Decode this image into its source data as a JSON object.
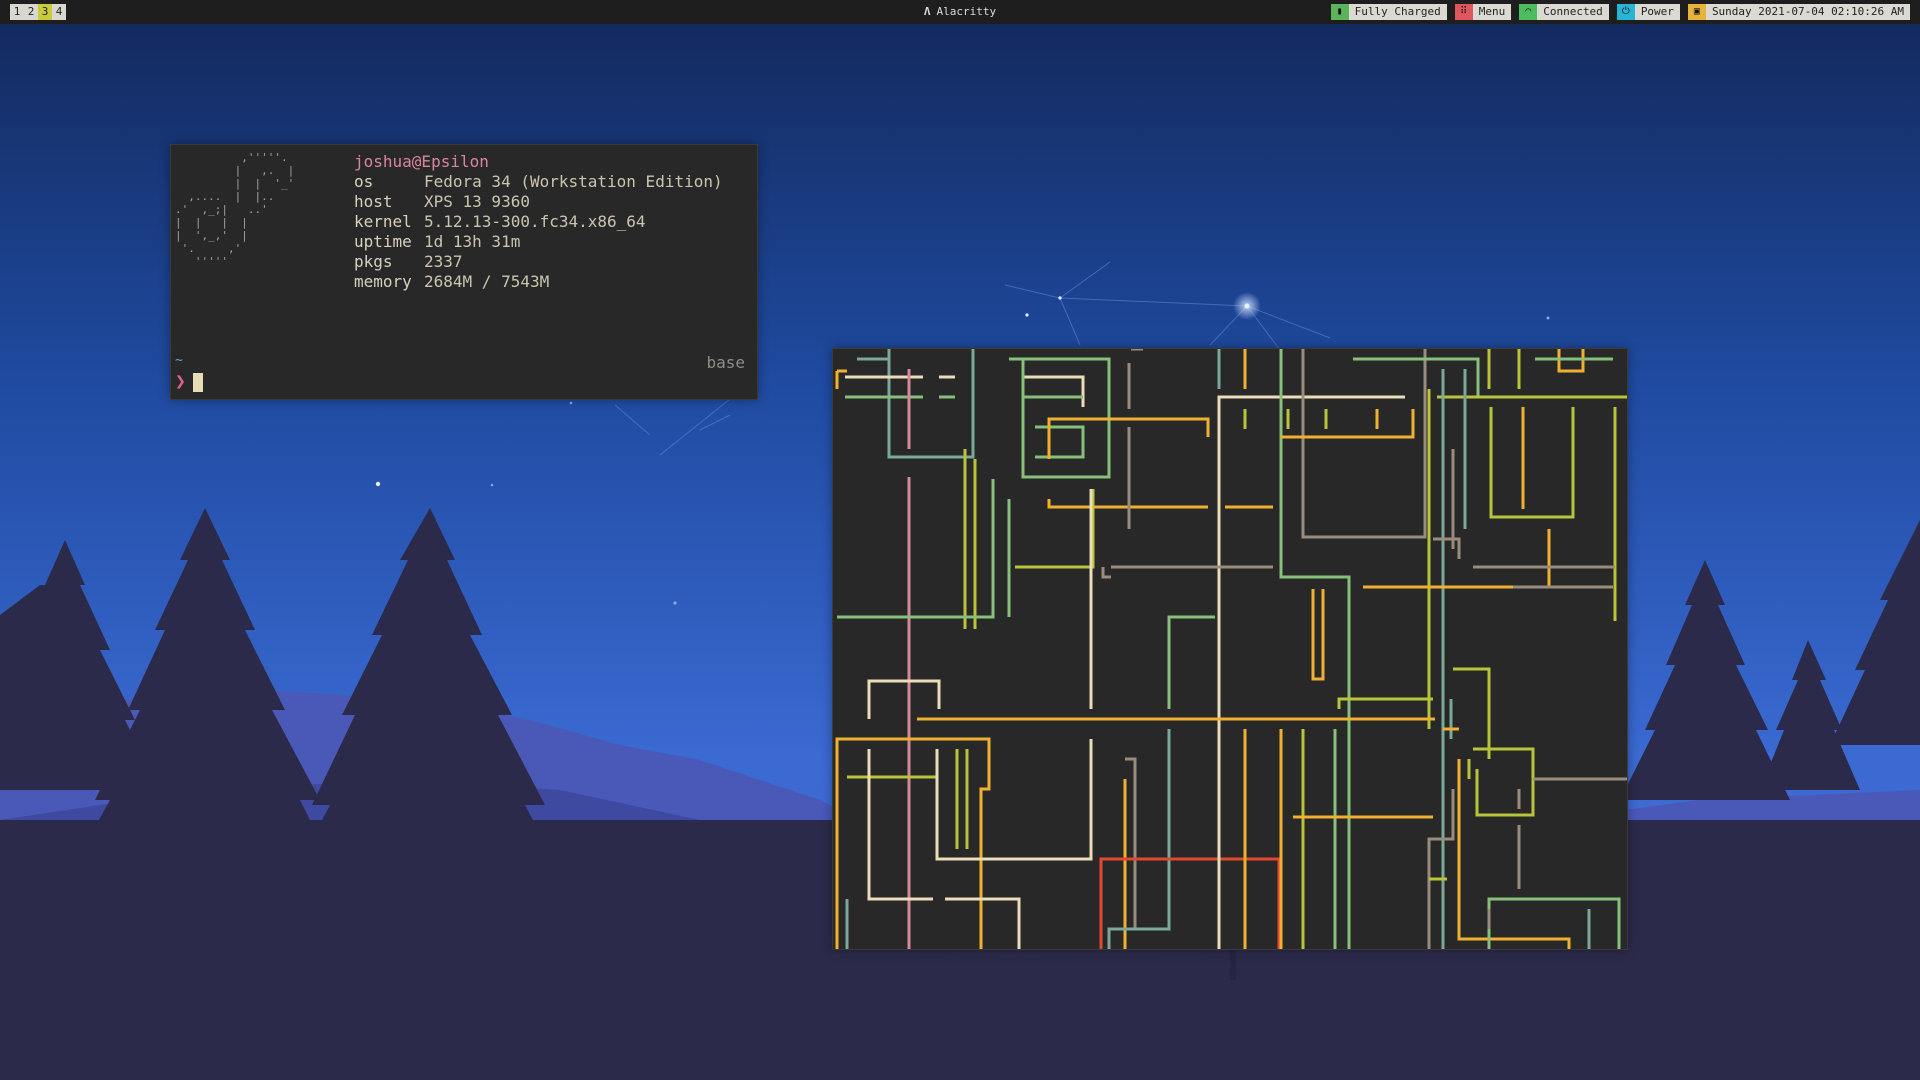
{
  "workspaces": [
    "1",
    "2",
    "3",
    "4"
  ],
  "active_workspace": "3",
  "window_title": "Alacritty",
  "status_modules": [
    {
      "name": "battery",
      "icon": "battery-icon",
      "label": "Fully Charged",
      "color": "#5ab45a"
    },
    {
      "name": "menu",
      "icon": "grid-icon",
      "label": "Menu",
      "color": "#e0565e"
    },
    {
      "name": "network",
      "icon": "wifi-icon",
      "label": "Connected",
      "color": "#4cbc5e"
    },
    {
      "name": "power",
      "icon": "power-icon",
      "label": "Power",
      "color": "#26b5d4"
    },
    {
      "name": "clock",
      "icon": "calendar-icon",
      "label": "Sunday 2021-07-04 02:10:26 AM",
      "color": "#e8b33a"
    }
  ],
  "fetch": {
    "user": "joshua@Epsilon",
    "rows": [
      {
        "key": "os",
        "value": "Fedora 34 (Workstation Edition)"
      },
      {
        "key": "host",
        "value": "XPS 13 9360"
      },
      {
        "key": "kernel",
        "value": "5.12.13-300.fc34.x86_64"
      },
      {
        "key": "uptime",
        "value": "1d 13h 31m"
      },
      {
        "key": "pkgs",
        "value": "2337"
      },
      {
        "key": "memory",
        "value": "2684M / 7543M"
      }
    ],
    "env": "base",
    "prompt_dir": "~",
    "prompt_symbol": "❯"
  },
  "colors": {
    "bar_bg": "#1e1e1e",
    "terminal_bg": "#282828",
    "pipe_orange": "#f0b030",
    "pipe_green": "#86c07a",
    "pipe_lime": "#b8c43a",
    "pipe_cream": "#eddcb8",
    "pipe_gray": "#9a8c7c",
    "pipe_teal": "#7aa89a",
    "pipe_pink": "#d58a9a",
    "pipe_red": "#e04830"
  }
}
